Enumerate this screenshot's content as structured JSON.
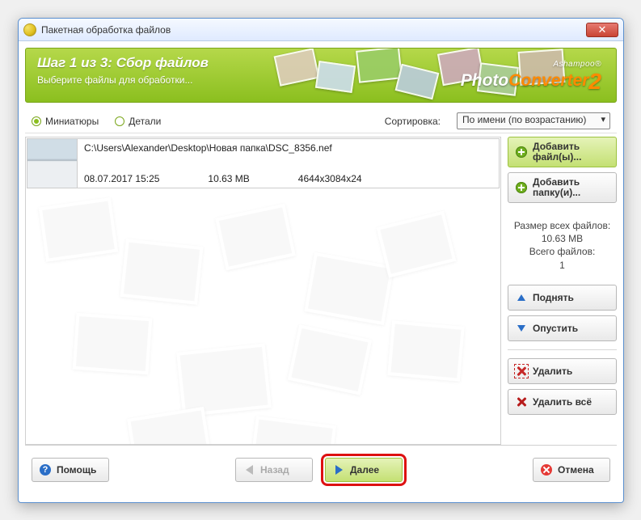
{
  "window": {
    "title": "Пакетная обработка файлов"
  },
  "banner": {
    "step_title": "Шаг 1 из 3: Сбор файлов",
    "step_subtitle": "Выберите файлы для обработки...",
    "brand_small": "Ashampoo®",
    "brand_photo": "Photo",
    "brand_conv": "Converter",
    "brand_ver": "2"
  },
  "toolbar": {
    "view_thumbs": "Миниатюры",
    "view_details": "Детали",
    "sort_label": "Сортировка:",
    "sort_selected": "По имени (по возрастанию)"
  },
  "file": {
    "path": "C:\\Users\\Alexander\\Desktop\\Новая папка\\DSC_8356.nef",
    "date": "08.07.2017 15:25",
    "size": "10.63 MB",
    "dims": "4644x3084x24"
  },
  "side": {
    "add_files": "Добавить файл(ы)...",
    "add_folders": "Добавить папку(и)...",
    "stats_size_label": "Размер всех файлов:",
    "stats_size_value": "10.63 MB",
    "stats_count_label": "Всего файлов:",
    "stats_count_value": "1",
    "move_up": "Поднять",
    "move_down": "Опустить",
    "delete": "Удалить",
    "delete_all": "Удалить всё"
  },
  "footer": {
    "help": "Помощь",
    "back": "Назад",
    "next": "Далее",
    "cancel": "Отмена"
  }
}
